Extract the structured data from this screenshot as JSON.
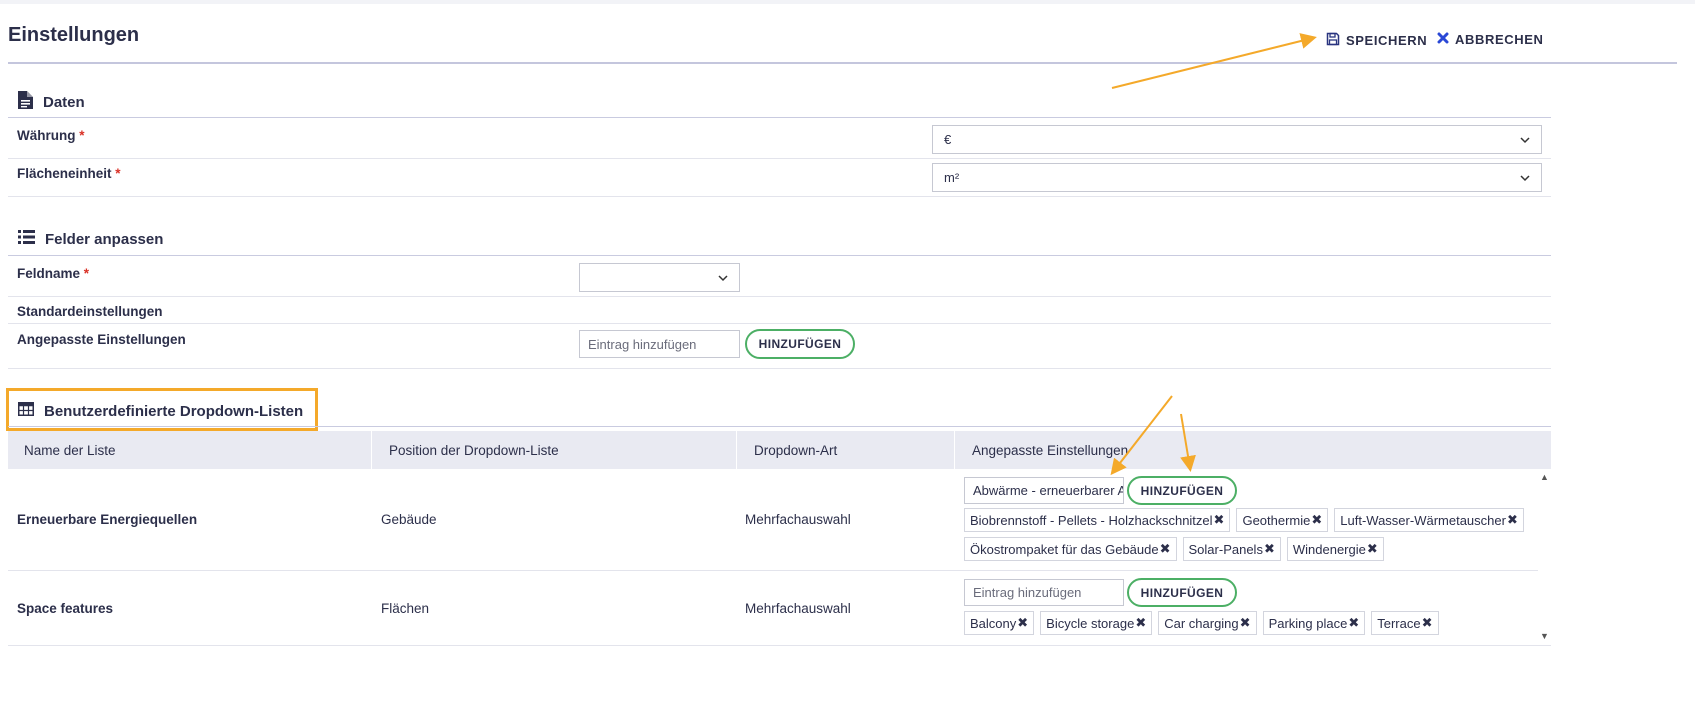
{
  "header": {
    "title": "Einstellungen",
    "save_label": "SPEICHERN",
    "cancel_label": "ABBRECHEN"
  },
  "daten": {
    "title": "Daten",
    "currency_label": "Währung",
    "currency_value": "€",
    "area_label": "Flächeneinheit",
    "area_value": "m²",
    "required_mark": "*"
  },
  "felder": {
    "title": "Felder anpassen",
    "fieldname_label": "Feldname",
    "fieldname_value": "",
    "default_label": "Standardeinstellungen",
    "custom_label": "Angepasste Einstellungen",
    "input_placeholder": "Eintrag hinzufügen",
    "add_label": "HINZUFÜGEN"
  },
  "dropdowns": {
    "title": "Benutzerdefinierte Dropdown-Listen",
    "columns": [
      "Name der Liste",
      "Position der Dropdown-Liste",
      "Dropdown-Art",
      "Angepasste Einstellungen"
    ],
    "rows": [
      {
        "name": "Erneuerbare Energiequellen",
        "position": "Gebäude",
        "type": "Mehrfachauswahl",
        "input_value": "Abwärme - erneuerbarer A",
        "add_label": "HINZUFÜGEN",
        "tags_line1": [
          "Biobrennstoff - Pellets - Holzhackschnitzel",
          "Geothermie",
          "Luft-Wasser-Wärmetauscher"
        ],
        "tags_line2": [
          "Ökostrompaket für das Gebäude",
          "Solar-Panels",
          "Windenergie"
        ]
      },
      {
        "name": "Space features",
        "position": "Flächen",
        "type": "Mehrfachauswahl",
        "input_placeholder": "Eintrag hinzufügen",
        "add_label": "HINZUFÜGEN",
        "tags_line1": [
          "Balcony",
          "Bicycle storage",
          "Car charging",
          "Parking place",
          "Terrace"
        ]
      }
    ]
  },
  "colors": {
    "accent_annotation": "#f4a92a",
    "add_button_border": "#4caf65",
    "cancel_icon": "#2a48d6",
    "header_divider": "#c4c6dd"
  },
  "icons": {
    "save": "floppy-disk-icon",
    "cancel": "x-icon",
    "daten": "document-icon",
    "felder": "list-icon",
    "dropdowns": "table-icon",
    "tag_remove": "x-icon",
    "select": "chevron-down-icon"
  }
}
